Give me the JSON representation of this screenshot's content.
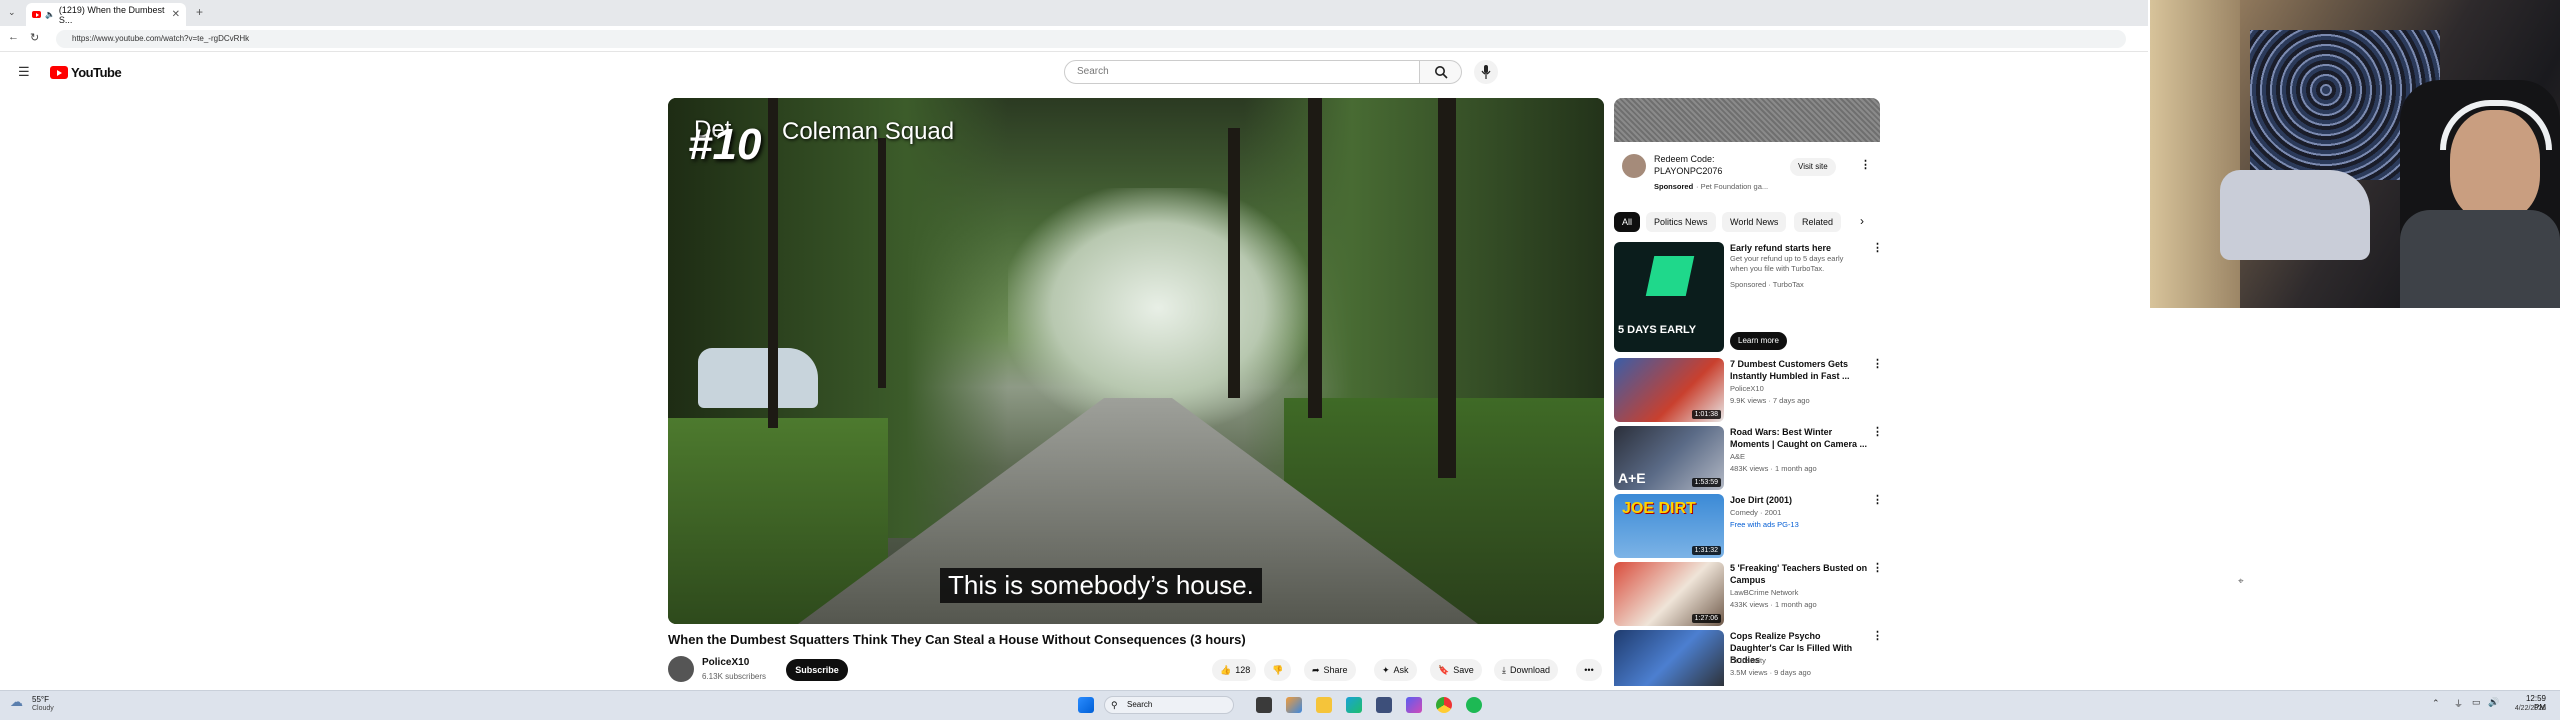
{
  "browser": {
    "tab_title": "(1219) When the Dumbest S...",
    "url": "https://www.youtube.com/watch?v=te_-rgDCvRHk"
  },
  "youtube": {
    "logo_text": "YouTube",
    "search_placeholder": "Search"
  },
  "video": {
    "overlay_title": "Coleman Squad",
    "overlay_prefix": "Det",
    "overlay_number": "#10",
    "caption": "This is somebody’s house.",
    "title": "When the Dumbest Squatters Think They Can Steal a House Without Consequences (3 hours)",
    "channel": "PoliceX10",
    "subscribers": "6.13K subscribers",
    "subscribe_label": "Subscribe",
    "likes": "128",
    "share_label": "Share",
    "ask_label": "Ask",
    "save_label": "Save",
    "download_label": "Download"
  },
  "sidebar": {
    "ad": {
      "title": "Redeem Code:",
      "subtitle": "PLAYONPC2076",
      "sponsored": "Sponsored",
      "advertiser": "· Pet Foundation ga...",
      "visit_label": "Visit site"
    },
    "chips": [
      "All",
      "Politics News",
      "World News",
      "Related"
    ],
    "recommendations": [
      {
        "title": "Early refund starts here",
        "line2": "Get your refund up to 5 days early when you file with TurboTax.",
        "line3": "Sponsored · TurboTax",
        "button": "Learn more",
        "thumb_text": "5 DAYS EARLY",
        "duration": ""
      },
      {
        "title": "7 Dumbest Customers Gets Instantly Humbled in Fast ...",
        "line2": "PoliceX10",
        "line3": "9.9K views · 7 days ago",
        "duration": "1:01:38"
      },
      {
        "title": "Road Wars: Best Winter Moments | Caught on Camera ...",
        "line2": "A&E",
        "line3": "483K views · 1 month ago",
        "duration": "1:53:59"
      },
      {
        "title": "Joe Dirt (2001)",
        "line2": "Comedy · 2001",
        "line3": "Free with ads  PG-13",
        "duration": "1:31:32",
        "thumb_text": "JOE DIRT"
      },
      {
        "title": "5 'Freaking' Teachers Busted on Campus",
        "line2": "LawBCrime Network",
        "line3": "433K views · 1 month ago",
        "duration": "1:27:06"
      },
      {
        "title": "Cops Realize Psycho Daughter's Car Is Filled With Bodies",
        "line2": "Dr Insanity",
        "line3": "3.5M views · 9 days ago",
        "duration": ""
      }
    ]
  },
  "taskbar": {
    "weather_temp": "55°F",
    "weather_desc": "Cloudy",
    "search_label": "Search",
    "time": "12:59 PM",
    "date": "4/22/2026"
  },
  "colors": {
    "youtube_red": "#ff0000",
    "taskbar_bg": "#dde3ec"
  }
}
